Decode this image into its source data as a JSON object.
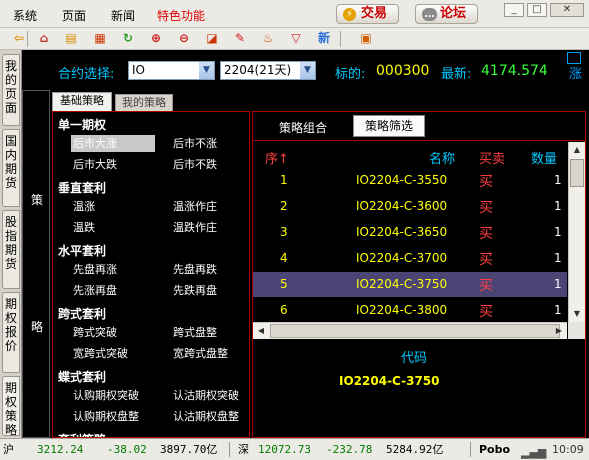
{
  "menu": [
    "系统",
    "页面",
    "新闻",
    "特色功能"
  ],
  "top_buttons": {
    "trade": "交易",
    "forum": "论坛"
  },
  "window_controls": [
    "_",
    "□",
    "✕"
  ],
  "toolbar_icons": [
    {
      "name": "back-arrow-icon",
      "glyph": "⇦",
      "color": "#e08a00"
    },
    {
      "name": "home-icon",
      "glyph": "⌂",
      "color": "#c0392b"
    },
    {
      "name": "news-icon",
      "glyph": "▤",
      "color": "#d88c00"
    },
    {
      "name": "calendar-icon",
      "glyph": "▦",
      "color": "#cc3300"
    },
    {
      "name": "refresh-icon",
      "glyph": "↻",
      "color": "#2a9d2a"
    },
    {
      "name": "zoom-in-icon",
      "glyph": "⊕",
      "color": "#d02020"
    },
    {
      "name": "zoom-out-icon",
      "glyph": "⊖",
      "color": "#d02020"
    },
    {
      "name": "window-icon",
      "glyph": "◪",
      "color": "#cc3300"
    },
    {
      "name": "pencil-icon",
      "glyph": "✎",
      "color": "#d02020"
    },
    {
      "name": "bell-icon",
      "glyph": "♨",
      "color": "#cc5500"
    },
    {
      "name": "filter-icon",
      "glyph": "▽",
      "color": "#d02020"
    },
    {
      "name": "new-icon",
      "glyph": "新",
      "color": "#2a6fdb"
    },
    {
      "name": "grid-view-icon",
      "glyph": "▣",
      "color": "#d06000"
    }
  ],
  "left_tabs": [
    "我的页面",
    "国内期货",
    "股指期货",
    "期权报价",
    "期权策略"
  ],
  "contract": {
    "label": "合约选择:",
    "value": "IO",
    "month": "2204(21天)",
    "target_label": "标的:",
    "target_code": "000300",
    "latest_label": "最新:",
    "latest_value": "4174.574",
    "right_label": "涨"
  },
  "strategy_side": [
    "策",
    "略"
  ],
  "strategy_tabs": [
    "基础策略",
    "我的策略"
  ],
  "strategy_categories": [
    {
      "title": "单一期权",
      "options": [
        "后市大涨",
        "后市不涨",
        "后市大跌",
        "后市不跌"
      ]
    },
    {
      "title": "垂直套利",
      "options": [
        "温涨",
        "温涨作庄",
        "温跌",
        "温跌作庄"
      ]
    },
    {
      "title": "水平套利",
      "options": [
        "先盘再涨",
        "先盘再跌",
        "先涨再盘",
        "先跌再盘"
      ]
    },
    {
      "title": "跨式套利",
      "options": [
        "跨式突破",
        "跨式盘整",
        "宽跨式突破",
        "宽跨式盘整"
      ]
    },
    {
      "title": "蝶式套利",
      "options": [
        "认购期权突破",
        "认沽期权突破",
        "认购期权盘整",
        "认沽期权盘整"
      ]
    },
    {
      "title": "套利策略",
      "options": []
    }
  ],
  "selected_option": "后市大涨",
  "right_tabs": [
    "策略组合",
    "策略筛选"
  ],
  "grid_headers": {
    "seq": "序↑",
    "name": "名称",
    "dir": "买卖",
    "qty": "数量"
  },
  "grid_rows": [
    {
      "seq": "1",
      "name": "IO2204-C-3550",
      "dir": "买",
      "qty": "1"
    },
    {
      "seq": "2",
      "name": "IO2204-C-3600",
      "dir": "买",
      "qty": "1"
    },
    {
      "seq": "3",
      "name": "IO2204-C-3650",
      "dir": "买",
      "qty": "1"
    },
    {
      "seq": "4",
      "name": "IO2204-C-3700",
      "dir": "买",
      "qty": "1"
    },
    {
      "seq": "5",
      "name": "IO2204-C-3750",
      "dir": "买",
      "qty": "1"
    },
    {
      "seq": "6",
      "name": "IO2204-C-3800",
      "dir": "买",
      "qty": "1"
    }
  ],
  "selected_row": 4,
  "code": {
    "label": "代码",
    "value": "IO2204-C-3750"
  },
  "status": {
    "sh_label": "沪",
    "sh_index": "3212.24",
    "sh_change": "-38.02",
    "sh_amount": "3897.70亿",
    "sz_label": "深",
    "sz_index": "12072.73",
    "sz_change": "-232.78",
    "sz_amount": "5284.92亿",
    "brand": "Pobo",
    "time": "10:09"
  }
}
